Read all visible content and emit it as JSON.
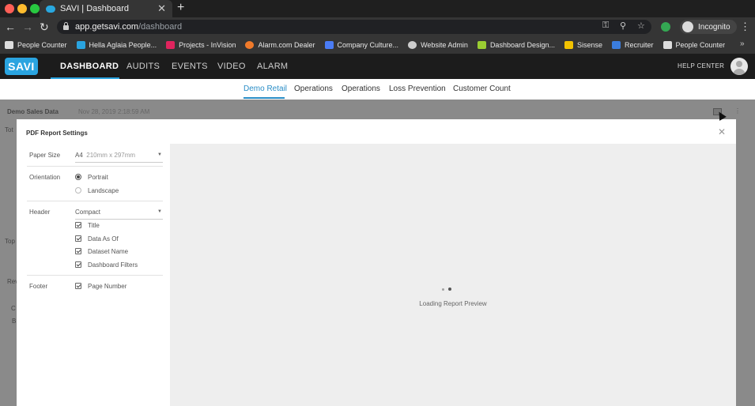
{
  "browser": {
    "tab_title": "SAVI | Dashboard",
    "tab_close": "✕",
    "new_tab": "+",
    "url_host": "app.getsavi.com",
    "url_path": "/dashboard",
    "incognito_label": "Incognito",
    "bookmarks": [
      {
        "label": "People Counter",
        "color": "#dddddd"
      },
      {
        "label": "Hella Aglaia People...",
        "color": "#2aa4e0"
      },
      {
        "label": "Projects - InVision",
        "color": "#e0245e"
      },
      {
        "label": "Alarm.com Dealer",
        "color": "#f07a2a"
      },
      {
        "label": "Company Culture...",
        "color": "#4a7cf5"
      },
      {
        "label": "Website Admin",
        "color": "#cccccc"
      },
      {
        "label": "Dashboard Design...",
        "color": "#9acd32"
      },
      {
        "label": "Sisense",
        "color": "#f2c200"
      },
      {
        "label": "Recruiter",
        "color": "#3b7ddd"
      },
      {
        "label": "People Counter",
        "color": "#dddddd"
      }
    ],
    "bookmarks_more": "»"
  },
  "app": {
    "logo": "SAVI",
    "nav": [
      "DASHBOARD",
      "AUDITS",
      "EVENTS",
      "VIDEO",
      "ALARM"
    ],
    "help": "HELP CENTER",
    "subtabs": [
      "Demo Retail",
      "Operations",
      "Operations",
      "Loss Prevention",
      "Customer Count"
    ],
    "accent": "#2a8ec7"
  },
  "dashboard_bg": {
    "dataset": "Demo Sales Data",
    "date": "Nov 28, 2019 2:18:59 AM",
    "frag_tot": "Tot",
    "frag_top": "Top",
    "frag_rev": "Rev",
    "frag_c": "C",
    "frag_b": "B"
  },
  "modal": {
    "title": "PDF Report Settings",
    "close": "✕",
    "paper_size_label": "Paper Size",
    "paper_size_value": "A4",
    "paper_size_detail": "210mm x 297mm",
    "orientation_label": "Orientation",
    "orientation_options": [
      "Portrait",
      "Landscape"
    ],
    "header_label": "Header",
    "header_value": "Compact",
    "header_options": [
      "Title",
      "Data As Of",
      "Dataset Name",
      "Dashboard Filters"
    ],
    "footer_label": "Footer",
    "footer_options": [
      "Page Number"
    ],
    "loading_text": "Loading Report Preview"
  }
}
